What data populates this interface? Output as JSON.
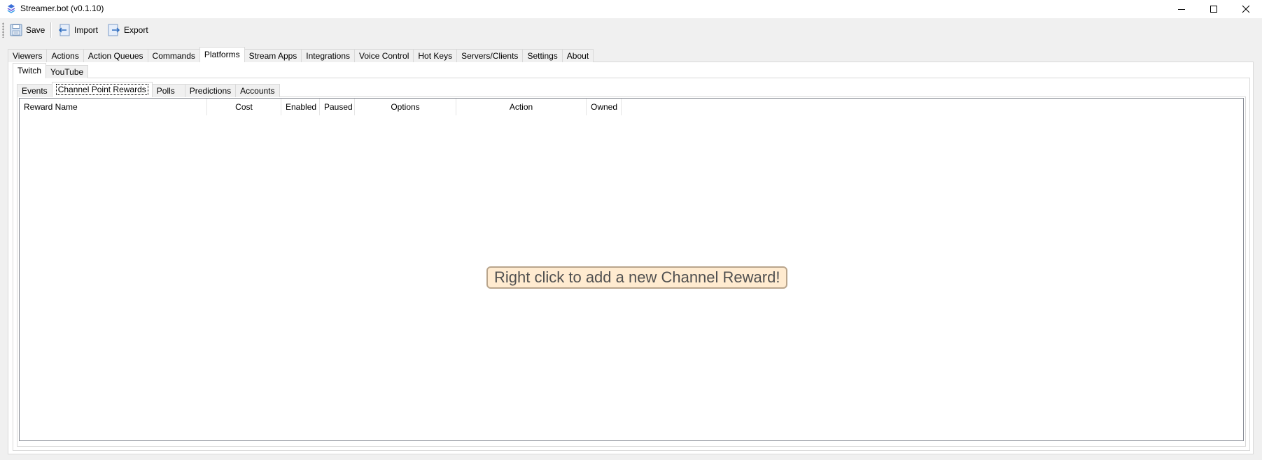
{
  "window": {
    "title": "Streamer.bot (v0.1.10)"
  },
  "toolbar": {
    "save_label": "Save",
    "import_label": "Import",
    "export_label": "Export"
  },
  "main_tabs": [
    "Viewers",
    "Actions",
    "Action Queues",
    "Commands",
    "Platforms",
    "Stream Apps",
    "Integrations",
    "Voice Control",
    "Hot Keys",
    "Servers/Clients",
    "Settings",
    "About"
  ],
  "main_tabs_active": "Platforms",
  "platform_tabs": [
    "Twitch",
    "YouTube"
  ],
  "platform_tabs_active": "Twitch",
  "sub_tabs": [
    "Events",
    "Channel Point Rewards",
    "Polls",
    "Predictions",
    "Accounts"
  ],
  "sub_tabs_active": "Channel Point Rewards",
  "rewards_table": {
    "columns": [
      "Reward Name",
      "Cost",
      "Enabled",
      "Paused",
      "Options",
      "Action",
      "Owned"
    ],
    "rows": []
  },
  "empty_message": "Right click to add a new Channel Reward!",
  "colors": {
    "empty_message_bg": "#ffebd0",
    "empty_message_border": "#b9a58c",
    "app_icon": "#3b6fd8"
  },
  "icons": {
    "app": "streamerbot-logo-icon",
    "save": "floppy-disk-icon",
    "import": "import-arrow-icon",
    "export": "export-arrow-icon",
    "minimize": "minimize-icon",
    "maximize": "maximize-icon",
    "close": "close-icon"
  }
}
